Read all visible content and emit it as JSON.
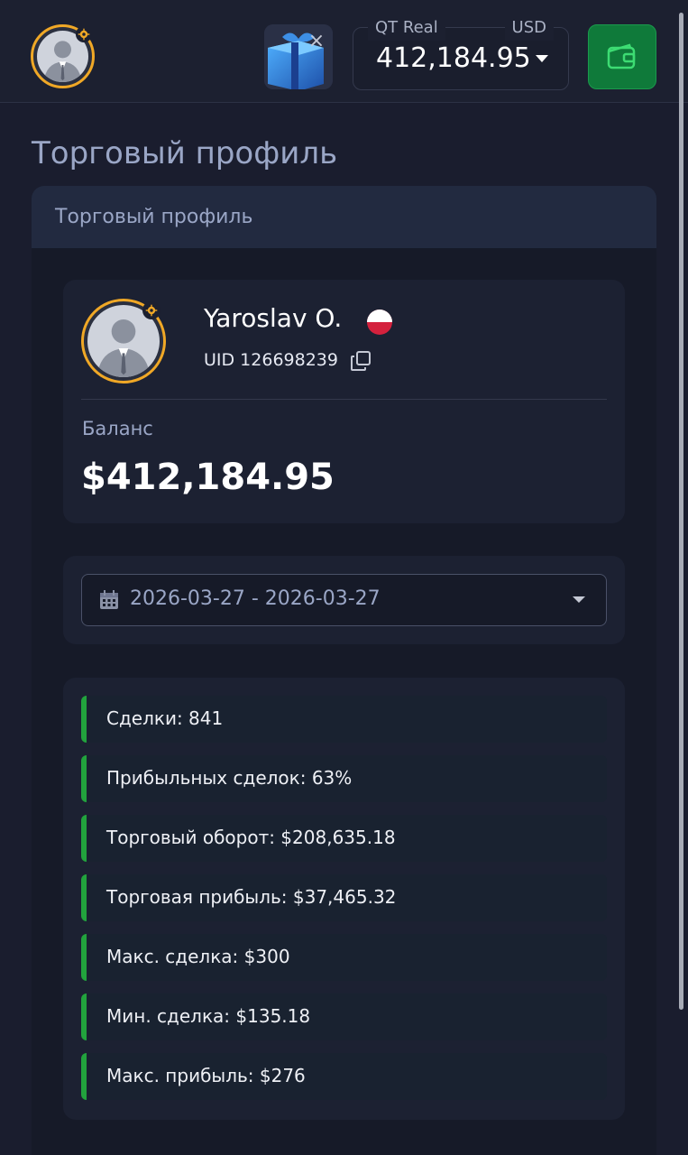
{
  "header": {
    "account_type": "QT Real",
    "currency": "USD",
    "balance": "412,184.95",
    "gift_close": "×"
  },
  "page": {
    "title": "Торговый профиль",
    "panel_title": "Торговый профиль"
  },
  "profile": {
    "name": "Yaroslav O.",
    "uid": "UID 126698239",
    "balance_label": "Баланс",
    "balance_value": "$412,184.95"
  },
  "filter": {
    "date_range": "2026-03-27 - 2026-03-27"
  },
  "stats": [
    "Сделки: 841",
    "Прибыльных сделок: 63%",
    "Торговый оборот: $208,635.18",
    "Торговая прибыль: $37,465.32",
    "Макс. сделка: $300",
    "Мин. сделка: $135.18",
    "Макс. прибыль: $276"
  ],
  "colors": {
    "accent_green": "#22a33d",
    "avatar_ring": "#f0a826",
    "wallet_button": "#0f7a3a"
  },
  "icons": [
    "avatar-icon",
    "gear-badge-icon",
    "gift-icon",
    "close-icon",
    "chevron-down-icon",
    "wallet-icon",
    "flag-poland-icon",
    "copy-icon",
    "calendar-icon"
  ]
}
